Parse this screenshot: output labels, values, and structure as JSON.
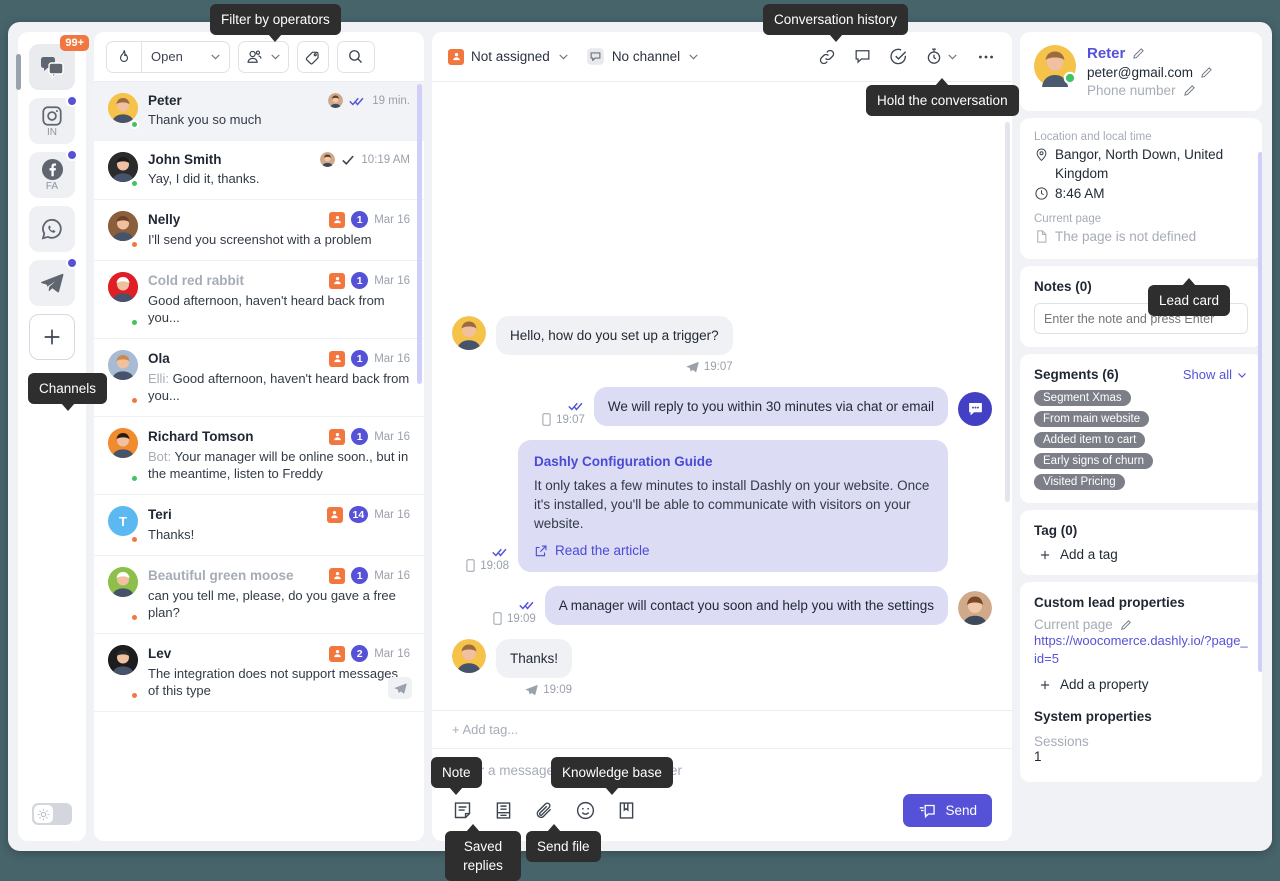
{
  "channels": {
    "rail_label": "Channels",
    "items": [
      {
        "name": "chats",
        "icon": "chats-icon",
        "label": "",
        "badge": "99+",
        "dot": false,
        "active": true
      },
      {
        "name": "instagram",
        "icon": "instagram-icon",
        "label": "IN",
        "badge": "",
        "dot": true,
        "active": false
      },
      {
        "name": "facebook",
        "icon": "facebook-icon",
        "label": "FA",
        "badge": "",
        "dot": true,
        "active": false
      },
      {
        "name": "whatsapp",
        "icon": "whatsapp-icon",
        "label": "",
        "badge": "",
        "dot": false,
        "active": false
      },
      {
        "name": "telegram",
        "icon": "telegram-icon",
        "label": "",
        "badge": "",
        "dot": true,
        "active": false
      }
    ],
    "add_label": "+",
    "theme_toggle_icon": "sun-icon"
  },
  "list_toolbar": {
    "status_icon": "fire-icon",
    "status_label": "Open",
    "operators_icon": "operators-icon",
    "tag_icon": "tag-icon",
    "search_icon": "search-icon"
  },
  "conversations": [
    {
      "name": "Peter",
      "preview": "Thank you so much",
      "prefix": "",
      "time": "19 min.",
      "avatar_color": "#f5c24a",
      "avatar_initial": "",
      "status": "#3fc45f",
      "read": "double",
      "operator_avatar": true,
      "assigned_icon": false,
      "count": "",
      "active": true,
      "muted_name": false
    },
    {
      "name": "John Smith",
      "preview": "Yay, I did it, thanks.",
      "prefix": "",
      "time": "10:19 AM",
      "avatar_color": "#2b2b2b",
      "avatar_initial": "",
      "status": "#3fc45f",
      "read": "single",
      "operator_avatar": true,
      "assigned_icon": false,
      "count": "",
      "active": false,
      "muted_name": false
    },
    {
      "name": "Nelly",
      "preview": "I'll send you screenshot with a problem",
      "prefix": "",
      "time": "Mar 16",
      "avatar_color": "#8b5e3c",
      "avatar_initial": "",
      "status": "#f2773f",
      "read": "",
      "operator_avatar": false,
      "assigned_icon": true,
      "count": "1",
      "active": false,
      "muted_name": false
    },
    {
      "name": "Cold red rabbit",
      "preview": "Good afternoon, haven't heard back from you...",
      "prefix": "",
      "time": "Mar 16",
      "avatar_color": "#e01e26",
      "avatar_initial": "",
      "status": "#3fc45f",
      "read": "",
      "operator_avatar": false,
      "assigned_icon": true,
      "count": "1",
      "active": false,
      "muted_name": true
    },
    {
      "name": "Ola",
      "preview": "Good afternoon, haven't heard back from you...",
      "prefix": "Elli:",
      "time": "Mar 16",
      "avatar_color": "#a7bcd4",
      "avatar_initial": "",
      "status": "#f2773f",
      "read": "",
      "operator_avatar": false,
      "assigned_icon": true,
      "count": "1",
      "active": false,
      "muted_name": false
    },
    {
      "name": "Richard Tomson",
      "preview": "Your manager will be online soon., but in the meantime, listen to Freddy",
      "prefix": "Bot:",
      "time": "Mar 16",
      "avatar_color": "#f08c2e",
      "avatar_initial": "",
      "status": "#3fc45f",
      "read": "",
      "operator_avatar": false,
      "assigned_icon": true,
      "count": "1",
      "active": false,
      "muted_name": false
    },
    {
      "name": "Teri",
      "preview": "Thanks!",
      "prefix": "",
      "time": "Mar 16",
      "avatar_color": "#5bb8f0",
      "avatar_initial": "T",
      "status": "#f2773f",
      "read": "",
      "operator_avatar": false,
      "assigned_icon": true,
      "count": "14",
      "active": false,
      "muted_name": false
    },
    {
      "name": "Beautiful green moose",
      "preview": "can you tell me, please, do you gave a free plan?",
      "prefix": "",
      "time": "Mar 16",
      "avatar_color": "#8cc04a",
      "avatar_initial": "",
      "status": "#f2773f",
      "read": "",
      "operator_avatar": false,
      "assigned_icon": true,
      "count": "1",
      "active": false,
      "muted_name": true
    },
    {
      "name": "Lev",
      "preview": "The integration does not support messages of this type",
      "prefix": "",
      "time": "Mar 16",
      "avatar_color": "#1d1d1d",
      "avatar_initial": "",
      "status": "#f2773f",
      "read": "",
      "operator_avatar": false,
      "assigned_icon": true,
      "count": "2",
      "active": false,
      "muted_name": false
    }
  ],
  "chat_header": {
    "assignee_icon": "person-assign-icon",
    "assignee_label": "Not assigned",
    "channel_icon": "channel-icon",
    "channel_label": "No channel",
    "actions": [
      "link-icon",
      "comment-icon",
      "check-circle-icon",
      "timer-icon",
      "more-icon"
    ]
  },
  "messages": [
    {
      "side": "in",
      "type": "text",
      "text": "Hello, how do you set up a trigger?",
      "time": "19:07",
      "time_icon": "sent-plane-icon",
      "read": "",
      "avatar": "user"
    },
    {
      "side": "out",
      "type": "text",
      "text": "We will reply to you within 30 minutes via chat or email",
      "time": "19:07",
      "time_icon": "mobile-icon",
      "read": "double",
      "avatar": "bot"
    },
    {
      "side": "out",
      "type": "card",
      "card_title": "Dashly Configuration Guide",
      "card_body": "It only takes a few minutes to install Dashly on your website. Once it's installed, you'll be able to communicate with visitors on your website.",
      "card_link": "Read the article",
      "time": "19:08",
      "time_icon": "mobile-icon",
      "read": "double",
      "avatar": ""
    },
    {
      "side": "out",
      "type": "text",
      "text": "A manager will contact you soon and help you with the settings",
      "time": "19:09",
      "time_icon": "mobile-icon",
      "read": "double",
      "avatar": "operator"
    },
    {
      "side": "in",
      "type": "text",
      "text": "Thanks!",
      "time": "19:09",
      "time_icon": "sent-plane-icon",
      "read": "",
      "avatar": "user"
    }
  ],
  "composer": {
    "tag_placeholder": "+ Add tag...",
    "message_placeholder": "Enter a message and press Ctrl+Enter",
    "tools": [
      "note-icon",
      "saved-replies-icon",
      "attach-icon",
      "emoji-icon",
      "knowledge-base-icon"
    ],
    "send_label": "Send",
    "send_icon": "send-icon"
  },
  "lead": {
    "name": "Reter",
    "email": "peter@gmail.com",
    "phone_placeholder": "Phone number",
    "location_label": "Location and local time",
    "location_value": "Bangor, North Down, United Kingdom",
    "local_time": "8:46 AM",
    "current_page_label": "Current page",
    "current_page_value": "The page is not defined",
    "notes_title": "Notes (0)",
    "notes_placeholder": "Enter the note and press Enter",
    "segments_title": "Segments (6)",
    "segments_show_all": "Show all",
    "segments": [
      "Segment Xmas",
      "From main website",
      "Added item to cart",
      "Early signs of churn",
      "Visited Pricing"
    ],
    "tag_title": "Tag (0)",
    "add_tag_label": "Add a tag",
    "custom_props_title": "Custom lead properties",
    "custom_prop_label": "Current page",
    "custom_prop_value": "https://woocomerce.dashly.io/?page_id=5",
    "add_property_label": "Add a property",
    "system_props_title": "System properties",
    "sessions_label": "Sessions",
    "sessions_value": "1"
  },
  "tooltips": {
    "filter_by_operators": "Filter by operators",
    "conversation_history": "Conversation history",
    "hold_the_conversation": "Hold the conversation",
    "lead_card": "Lead card",
    "channels": "Channels",
    "note": "Note",
    "saved_replies": "Saved replies",
    "send_file": "Send file",
    "knowledge_base": "Knowledge base"
  },
  "colors": {
    "accent": "#5552d8",
    "orange": "#f2773f",
    "online": "#3fc45f",
    "away": "#f2773f",
    "page_bg": "#47646b"
  }
}
